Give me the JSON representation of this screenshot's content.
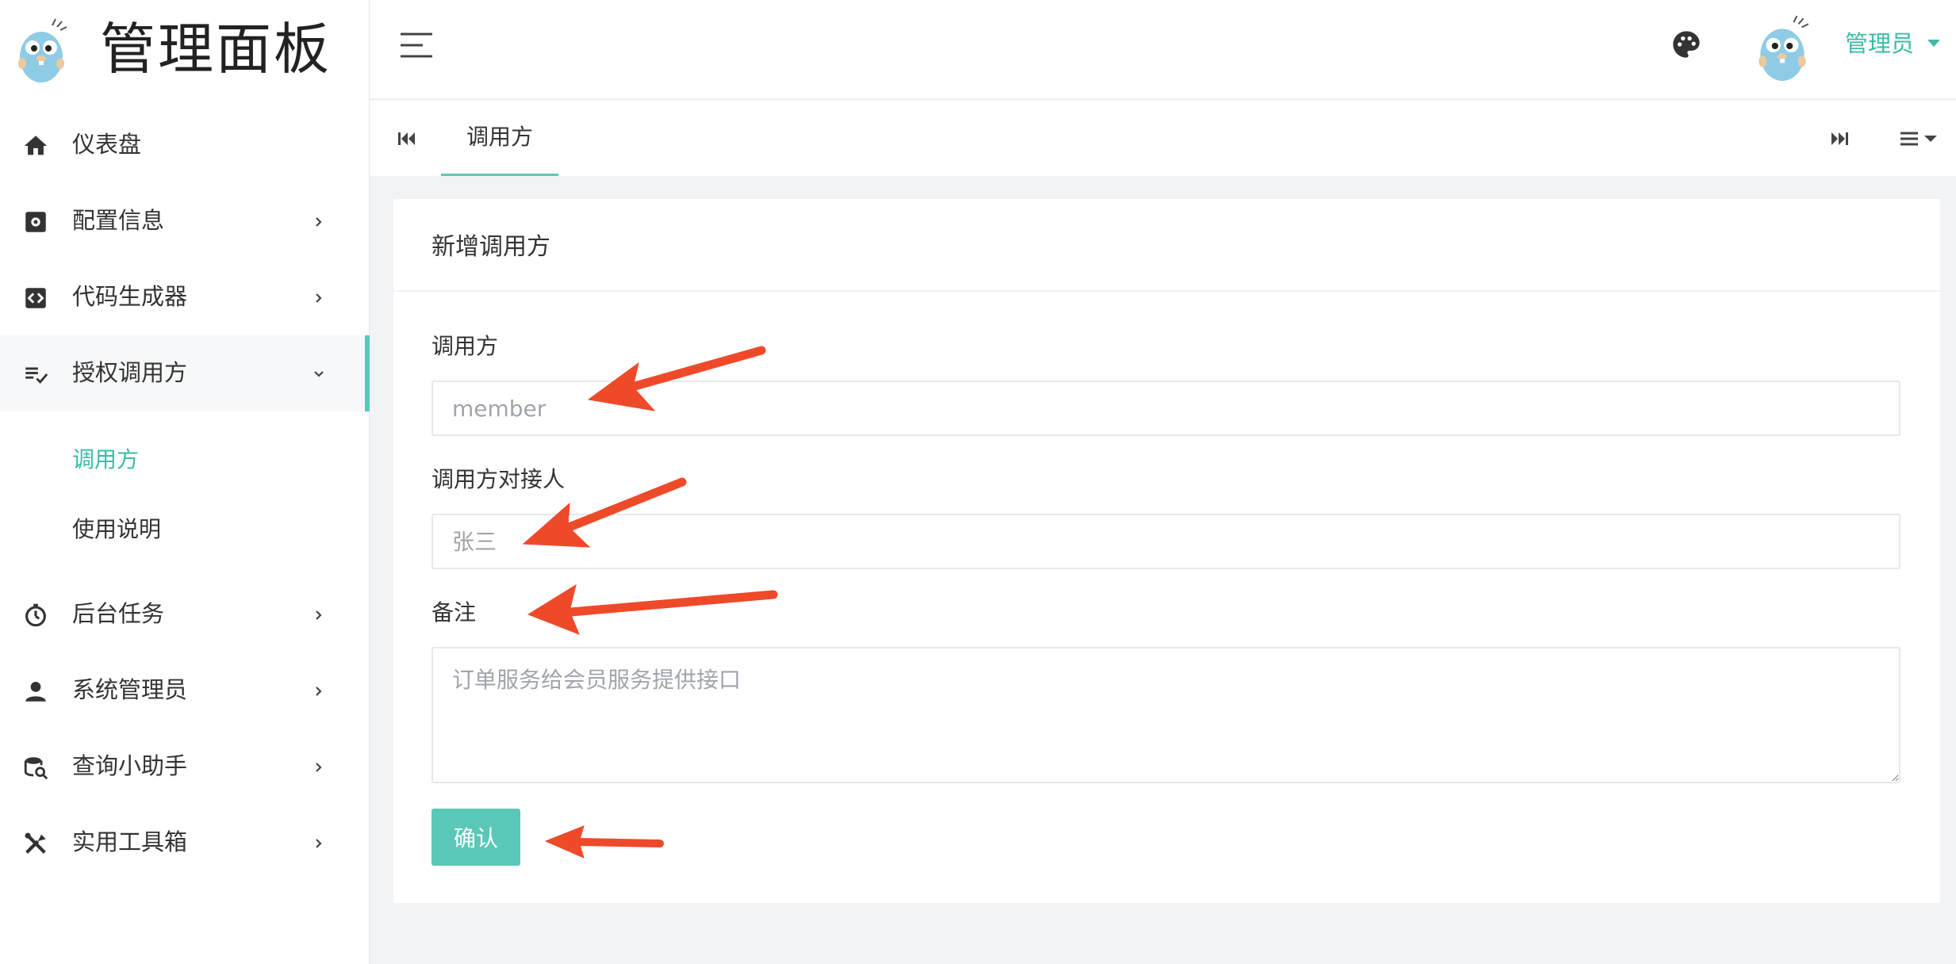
{
  "brand": {
    "title": "管理面板"
  },
  "sidebar": {
    "items": [
      {
        "label": "仪表盘",
        "icon": "home-icon"
      },
      {
        "label": "配置信息",
        "icon": "settings-icon"
      },
      {
        "label": "代码生成器",
        "icon": "code-icon"
      },
      {
        "label": "授权调用方",
        "icon": "list-check-icon",
        "expanded": true,
        "children": [
          {
            "label": "调用方",
            "active": true
          },
          {
            "label": "使用说明"
          }
        ]
      },
      {
        "label": "后台任务",
        "icon": "timer-icon"
      },
      {
        "label": "系统管理员",
        "icon": "user-icon"
      },
      {
        "label": "查询小助手",
        "icon": "database-search-icon"
      },
      {
        "label": "实用工具箱",
        "icon": "tools-icon"
      }
    ]
  },
  "header": {
    "user_name": "管理员"
  },
  "tabs": [
    {
      "label": "调用方",
      "active": true
    }
  ],
  "form": {
    "title": "新增调用方",
    "fields": [
      {
        "label": "调用方",
        "placeholder": "member"
      },
      {
        "label": "调用方对接人",
        "placeholder": "张三"
      },
      {
        "label": "备注",
        "placeholder": "订单服务给会员服务提供接口"
      }
    ],
    "submit_label": "确认"
  },
  "colors": {
    "accent": "#5bc7b8",
    "accent_text": "#3cbba6",
    "annotation_arrow": "#ee4a2a"
  }
}
